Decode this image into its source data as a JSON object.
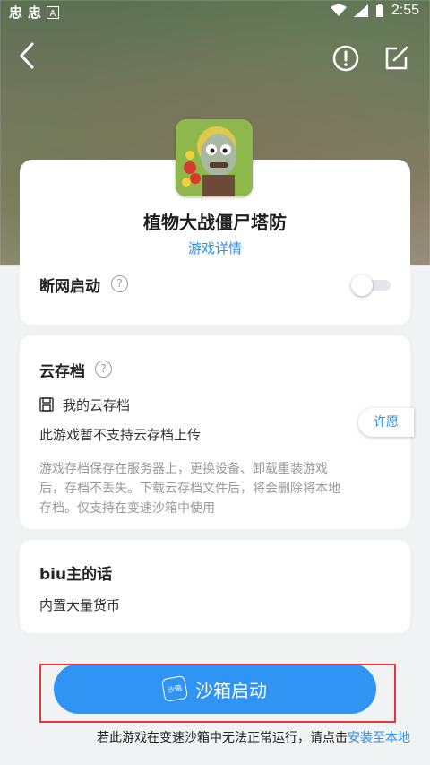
{
  "status_bar": {
    "time": "2:55"
  },
  "game": {
    "title": "植物大战僵尸塔防",
    "detail_link": "游戏详情"
  },
  "offline_start": {
    "label": "断网启动"
  },
  "cloud_save": {
    "label": "云存档",
    "my_cloud_save": "我的云存档",
    "unsupported_text": "此游戏暂不支持云存档上传",
    "permit_button": "许愿",
    "description_lines": [
      "游戏存档保存在服务器上，更换设备、卸载重装游戏",
      "后，存档不丢失。下载云存档文件后，将会删除将本地",
      "存档。仅支持在变速沙箱中使用"
    ]
  },
  "biu_words": {
    "label": "biu主的话",
    "text": "内置大量货币"
  },
  "launch": {
    "label": "沙箱启动",
    "icon_text": "沙箱"
  },
  "footer": {
    "note": "若此游戏在变速沙箱中无法正常运行，请点击",
    "link": "安装至本地"
  },
  "colors": {
    "accent": "#2f94f3",
    "link": "#2f8ee6",
    "highlight_box": "#e53935"
  }
}
